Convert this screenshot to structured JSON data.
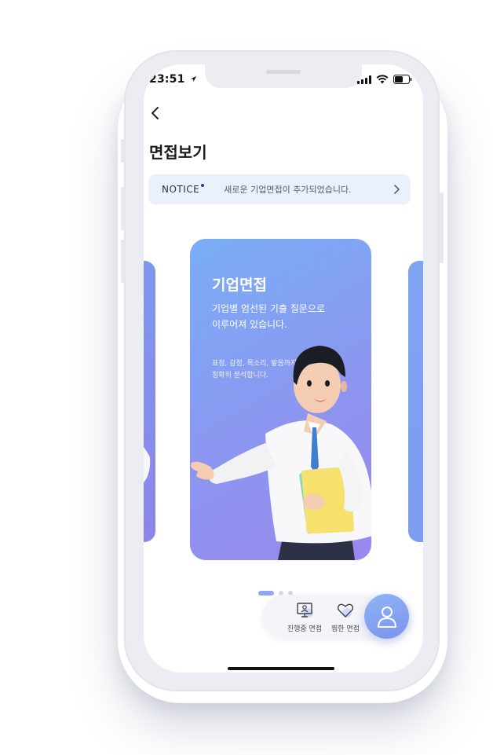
{
  "status_bar": {
    "time": "23:51"
  },
  "header": {
    "back_icon": "chevron-left-icon",
    "title": "면접보기"
  },
  "notice": {
    "label": "NOTICE",
    "text": "새로운 기업면접이 추가되었습니다.",
    "arrow_icon": "chevron-right-icon"
  },
  "card": {
    "title": "기업면접",
    "description_line1": "기업별 엄선된 기출 질문으로",
    "description_line2": "이루어져 있습니다.",
    "sub_line1": "표정, 감정, 목소리, 발음까지",
    "sub_line2": "정확히 분석합니다."
  },
  "pager": {
    "total": 3,
    "active_index": 0
  },
  "bottom_nav": {
    "tab_in_progress": {
      "label": "진행중 면접",
      "icon": "monitor-icon"
    },
    "tab_saved": {
      "label": "찜한 면접",
      "icon": "heart-icon"
    },
    "profile_icon": "user-icon"
  },
  "colors": {
    "accent": "#8a98f0",
    "card_gradient_start": "#79aef6",
    "card_gradient_end": "#9a87ed",
    "notice_bg": "#ebf1fc"
  }
}
